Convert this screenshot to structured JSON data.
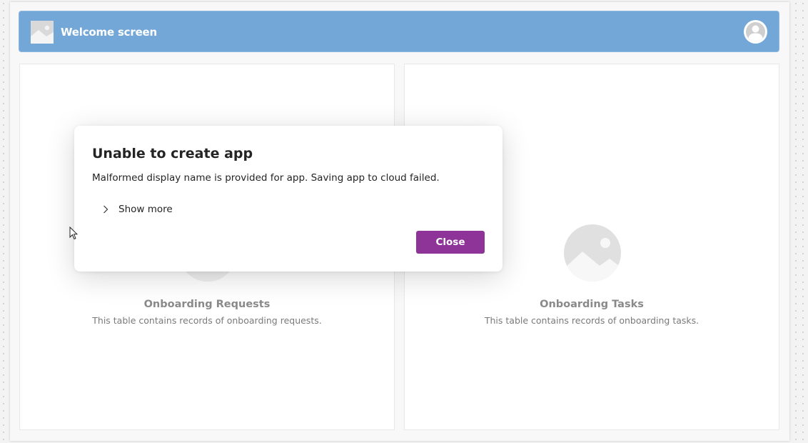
{
  "header": {
    "title": "Welcome screen",
    "logo_icon": "image-placeholder-icon",
    "avatar_icon": "user-avatar-icon",
    "color": "#72a7d7"
  },
  "cards": [
    {
      "title": "Onboarding Requests",
      "description": "This table contains records of onboarding requests.",
      "icon": "image-placeholder-icon"
    },
    {
      "title": "Onboarding Tasks",
      "description": "This table contains records of onboarding tasks.",
      "icon": "image-placeholder-icon"
    }
  ],
  "dialog": {
    "title": "Unable to create app",
    "message": "Malformed display name is provided for app. Saving app to cloud failed.",
    "show_more_label": "Show more",
    "close_label": "Close",
    "close_color": "#8e3499"
  }
}
